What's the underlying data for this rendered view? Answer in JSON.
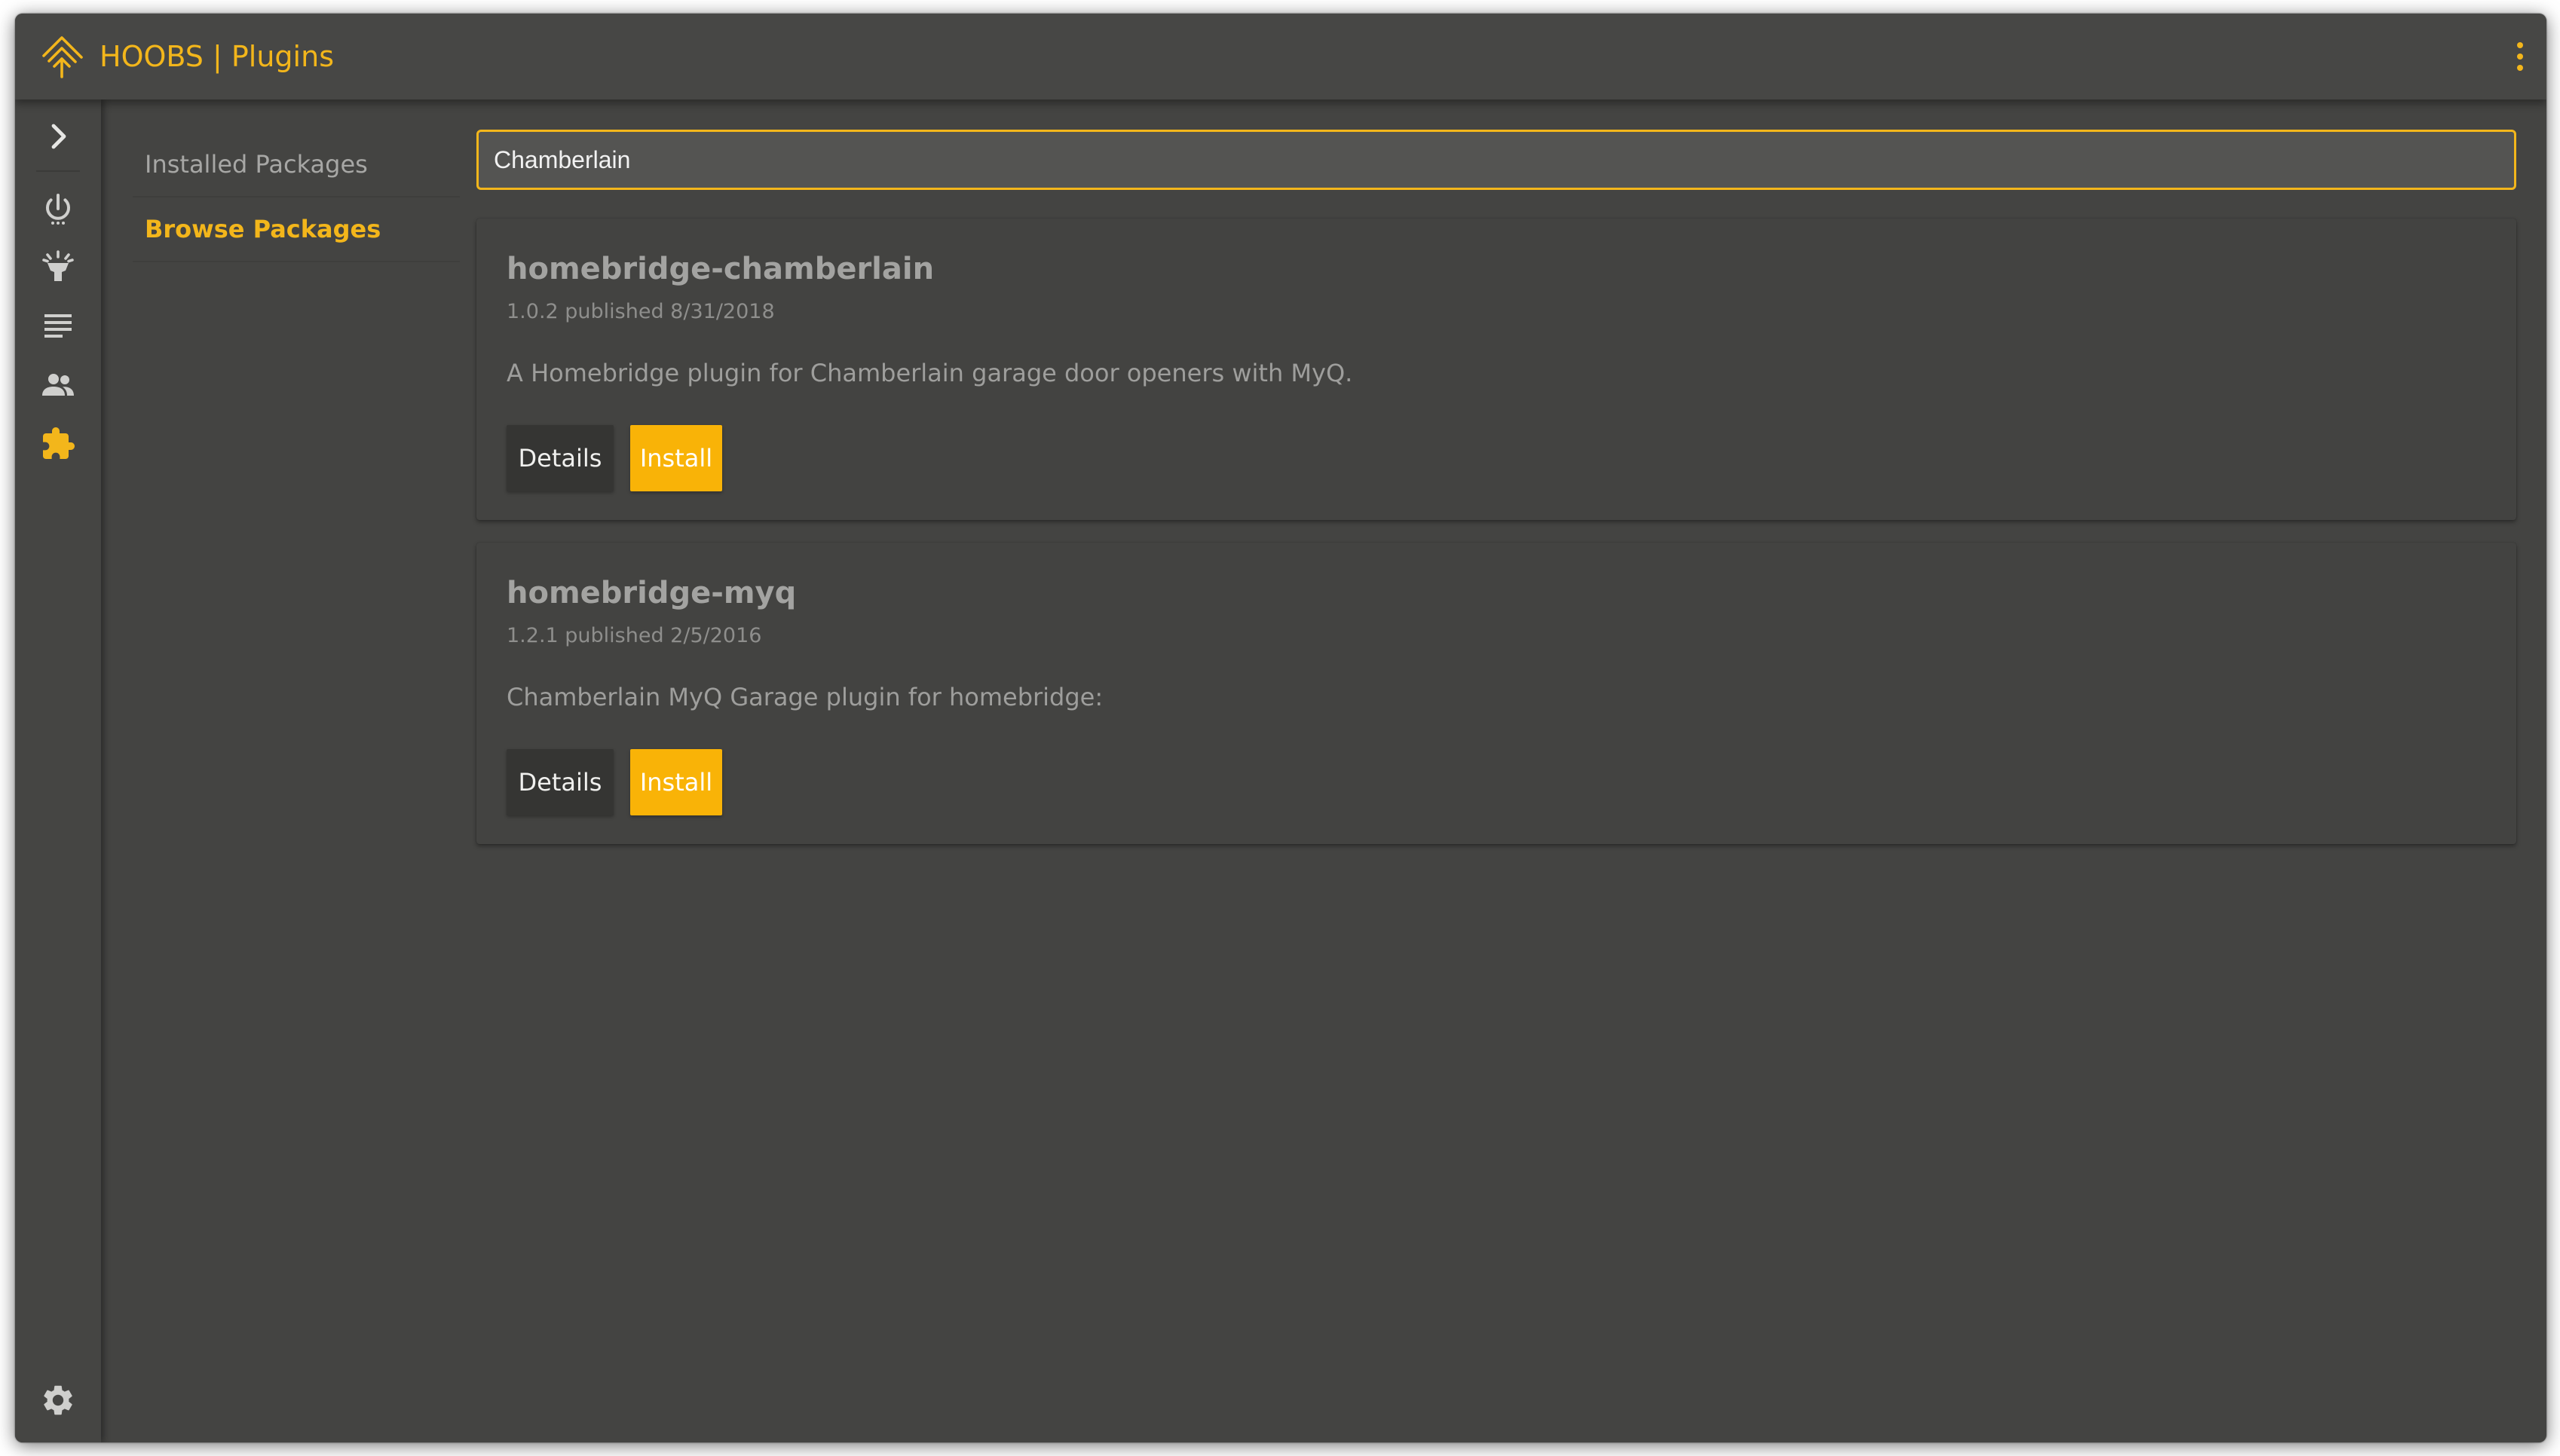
{
  "header": {
    "app_title": "HOOBS | Plugins",
    "accent_color": "#f3b61b",
    "logo_icon": "hoobs-logo-icon",
    "menu_icon": "more-vertical-icon"
  },
  "sidebar": {
    "items": [
      {
        "name": "expand",
        "icon": "chevron-right-icon",
        "active": false
      },
      {
        "name": "power",
        "icon": "power-icon",
        "active": false
      },
      {
        "name": "accessories",
        "icon": "lightbulb-icon",
        "active": false
      },
      {
        "name": "log",
        "icon": "list-icon",
        "active": false
      },
      {
        "name": "users",
        "icon": "people-icon",
        "active": false
      },
      {
        "name": "plugins",
        "icon": "puzzle-icon",
        "active": true
      },
      {
        "name": "settings",
        "icon": "gear-icon",
        "active": false
      }
    ]
  },
  "subnav": {
    "items": [
      {
        "label": "Installed Packages",
        "active": false
      },
      {
        "label": "Browse Packages",
        "active": true
      }
    ]
  },
  "search": {
    "value": "Chamberlain",
    "placeholder": ""
  },
  "results": [
    {
      "title": "homebridge-chamberlain",
      "meta": "1.0.2 published 8/31/2018",
      "description": "A Homebridge plugin for Chamberlain garage door openers with MyQ.",
      "details_label": "Details",
      "install_label": "Install"
    },
    {
      "title": "homebridge-myq",
      "meta": "1.2.1 published 2/5/2016",
      "description": "Chamberlain MyQ Garage plugin for homebridge:",
      "details_label": "Details",
      "install_label": "Install"
    }
  ]
}
